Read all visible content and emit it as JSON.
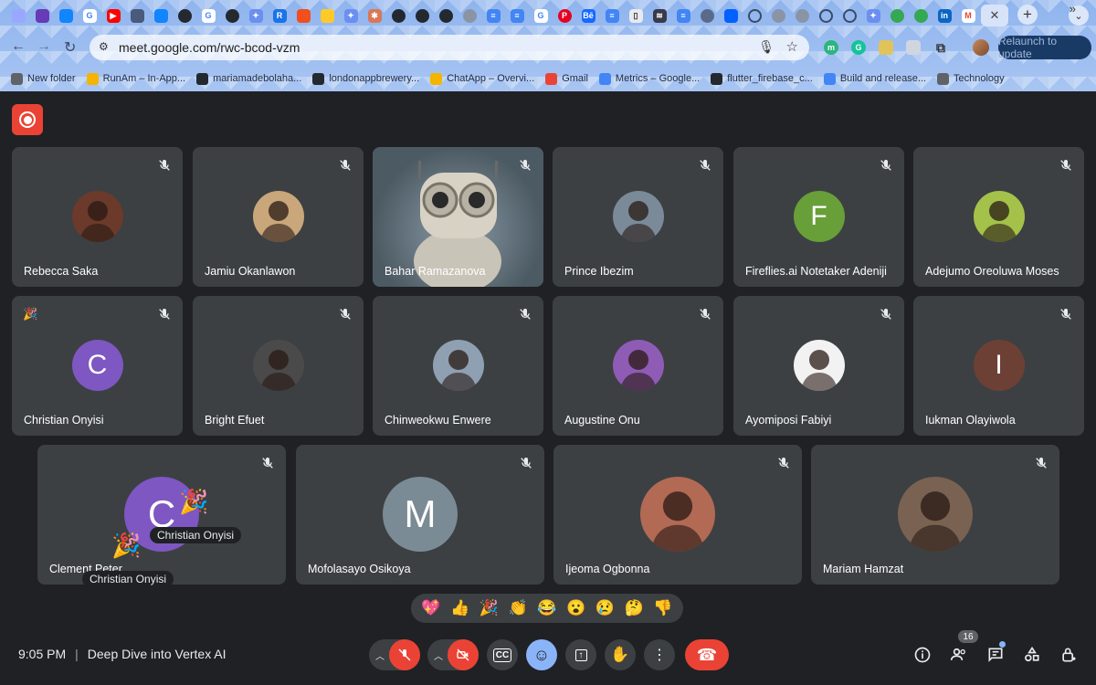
{
  "browser": {
    "url": "meet.google.com/rwc-bcod-vzm",
    "relaunch_label": "Relaunch to update",
    "bookmarks": [
      {
        "label": "New folder",
        "color": "#5f6368"
      },
      {
        "label": "RunAm – In-App...",
        "color": "#f4b400"
      },
      {
        "label": "mariamadebolaha...",
        "color": "#24292f"
      },
      {
        "label": "londonappbrewery...",
        "color": "#24292f"
      },
      {
        "label": "ChatApp – Overvi...",
        "color": "#f4b400"
      },
      {
        "label": "Gmail",
        "color": "#ea4335"
      },
      {
        "label": "Metrics – Google...",
        "color": "#4285f4"
      },
      {
        "label": "flutter_firebase_c...",
        "color": "#24292f"
      },
      {
        "label": "Build and release...",
        "color": "#4285f4"
      },
      {
        "label": "Technology",
        "color": "#5f6368"
      }
    ]
  },
  "meeting": {
    "time": "9:05 PM",
    "title": "Deep Dive into Vertex AI",
    "participant_count": "16",
    "participants": [
      {
        "name": "Rebecca Saka",
        "initial": "",
        "color": "#6b3a2a"
      },
      {
        "name": "Jamiu Okanlawon",
        "initial": "",
        "color": "#c9a77a"
      },
      {
        "name": "Bahar Ramazanova",
        "initial": "",
        "color": ""
      },
      {
        "name": "Prince Ibezim",
        "initial": "",
        "color": "#7a8a99"
      },
      {
        "name": "Fireflies.ai Notetaker Adeniji",
        "initial": "F",
        "color": "#689f38"
      },
      {
        "name": "Adejumo Oreoluwa Moses",
        "initial": "",
        "color": "#a4c24a"
      },
      {
        "name": "Christian Onyisi",
        "initial": "C",
        "color": "#7e57c2"
      },
      {
        "name": "Bright Efuet",
        "initial": "",
        "color": "#4a4a4a"
      },
      {
        "name": "Chinweokwu Enwere",
        "initial": "",
        "color": "#8fa0b2"
      },
      {
        "name": "Augustine Onu",
        "initial": "",
        "color": "#8e5bb5"
      },
      {
        "name": "Ayomiposi Fabiyi",
        "initial": "",
        "color": "#f2f2f2"
      },
      {
        "name": "Iukman Olayiwola",
        "initial": "I",
        "color": "#6d4035"
      },
      {
        "name": "Clement Peter",
        "initial": "C",
        "color": "#7e57c2"
      },
      {
        "name": "Mofolasayo Osikoya",
        "initial": "M",
        "color": "#7b8b95"
      },
      {
        "name": "Ijeoma Ogbonna",
        "initial": "",
        "color": "#b26a55"
      },
      {
        "name": "Mariam Hamzat",
        "initial": "",
        "color": "#7a6252"
      }
    ],
    "reaction_chips": [
      "Christian Onyisi",
      "Christian Onyisi"
    ],
    "reactions": [
      "💖",
      "👍",
      "🎉",
      "👏",
      "😂",
      "😮",
      "😢",
      "🤔",
      "👎"
    ]
  }
}
